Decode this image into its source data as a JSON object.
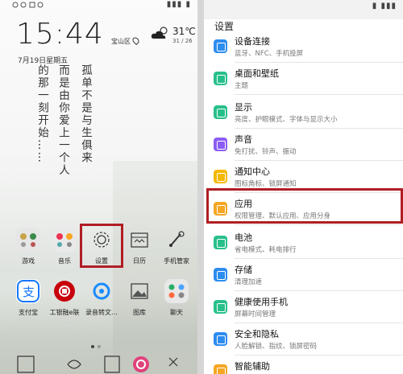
{
  "left": {
    "status_right": "▮▮▮ ▮",
    "clock": "15:44",
    "location": "宝山区",
    "temp": "31℃",
    "temp_range": "31 / 26",
    "date": "7月19日星期五",
    "poem": [
      "的那一刻开始……",
      "而是由你爱上一个人",
      "孤单不是与生俱来"
    ],
    "apps_row1": [
      "游戏",
      "音乐",
      "设置",
      "日历",
      "手机管家"
    ],
    "apps_row2": [
      "支付宝",
      "工银融e联",
      "录音转文…",
      "图库",
      "聊天"
    ],
    "colors": {
      "highlight": "#b01e24"
    }
  },
  "right": {
    "status_right": "▮ ▮▮▮",
    "title": "设置",
    "items": [
      {
        "title": "设备连接",
        "sub": "蓝牙、NFC、手机投屏",
        "color": "#2d8cf0",
        "icon": "link-icon"
      },
      {
        "title": "桌面和壁纸",
        "sub": "主题",
        "color": "#27c08a",
        "icon": "wallpaper-icon"
      },
      {
        "title": "显示",
        "sub": "亮度、护眼模式、字体与显示大小",
        "color": "#27c08a",
        "icon": "display-icon"
      },
      {
        "title": "声音",
        "sub": "免打扰、铃声、振动",
        "color": "#8b5cf6",
        "icon": "sound-icon"
      },
      {
        "title": "通知中心",
        "sub": "图标角标、锁屏通知",
        "color": "#f5b800",
        "icon": "bell-icon"
      },
      {
        "title": "应用",
        "sub": "权限管理、默认应用、应用分身",
        "color": "#f5a623",
        "icon": "apps-icon"
      },
      {
        "title": "电池",
        "sub": "省电模式、耗电排行",
        "color": "#27c08a",
        "icon": "battery-icon"
      },
      {
        "title": "存储",
        "sub": "清理加速",
        "color": "#2d8cf0",
        "icon": "storage-icon"
      },
      {
        "title": "健康使用手机",
        "sub": "屏幕时间管理",
        "color": "#27c08a",
        "icon": "hourglass-icon"
      },
      {
        "title": "安全和隐私",
        "sub": "人脸解锁、指纹、锁屏密码",
        "color": "#2d8cf0",
        "icon": "shield-icon"
      },
      {
        "title": "智能辅助",
        "sub": "",
        "color": "#f5a623",
        "icon": "assist-icon"
      }
    ]
  }
}
